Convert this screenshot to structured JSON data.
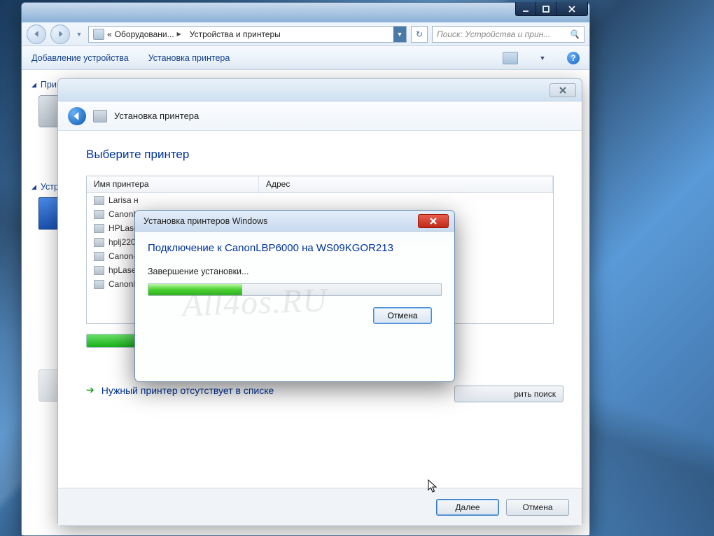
{
  "explorer": {
    "breadcrumb": {
      "seg1": "Оборудовани...",
      "seg2": "Устройства и принтеры"
    },
    "search_placeholder": "Поиск: Устройства и прин...",
    "toolbar": {
      "add_device": "Добавление устройства",
      "install_printer": "Установка принтера"
    },
    "groups": {
      "printers": "Принтеры и факсы (2)",
      "devices": "Устройства"
    }
  },
  "wizard": {
    "header_label": "Установка принтера",
    "heading": "Выберите принтер",
    "columns": {
      "name": "Имя принтера",
      "address": "Адрес"
    },
    "rows": [
      "Larisa н",
      "CanonL",
      "HPLaser",
      "hplj220",
      "Canon-",
      "hpLaser",
      "CanonL"
    ],
    "search_again": "рить поиск",
    "missing_link": "Нужный принтер отсутствует в списке",
    "next": "Далее",
    "cancel": "Отмена",
    "progress_percent": 100
  },
  "progress": {
    "title": "Установка принтеров Windows",
    "heading": "Подключение к CanonLBP6000 на WS09KGOR213",
    "status": "Завершение установки...",
    "percent": 32,
    "cancel": "Отмена"
  },
  "watermark": "All4os.RU"
}
